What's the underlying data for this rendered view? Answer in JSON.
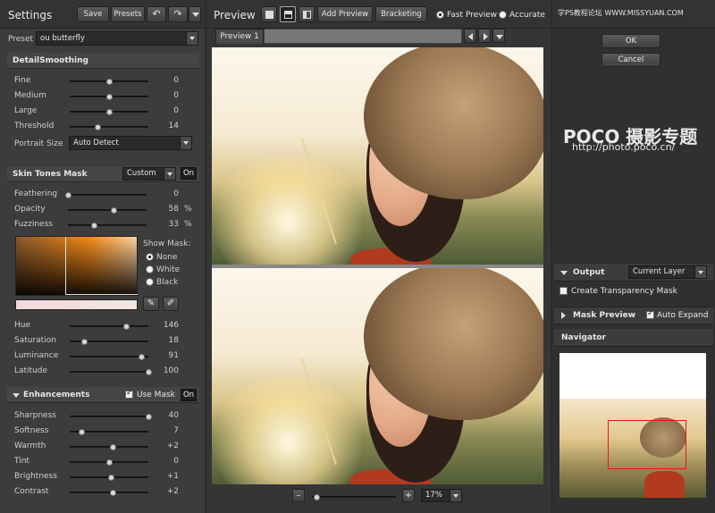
{
  "left": {
    "title": "Settings",
    "save_label": "Save",
    "presets_label": "Presets",
    "preset_label": "Preset",
    "preset_value": "ou butterfly",
    "detail": {
      "title": "DetailSmoothing",
      "sliders": [
        {
          "label": "Fine",
          "value": "0",
          "pos": 0.5
        },
        {
          "label": "Medium",
          "value": "0",
          "pos": 0.5
        },
        {
          "label": "Large",
          "value": "0",
          "pos": 0.5
        },
        {
          "label": "Threshold",
          "value": "14",
          "pos": 0.35
        }
      ],
      "portrait_label": "Portrait Size",
      "portrait_value": "Auto Detect"
    },
    "skin": {
      "title": "Skin Tones Mask",
      "mode": "Custom",
      "on_label": "On",
      "sliders": [
        {
          "label": "Feathering",
          "value": "0",
          "unit": "",
          "pos": 0.0
        },
        {
          "label": "Opacity",
          "value": "58",
          "unit": "%",
          "pos": 0.58
        },
        {
          "label": "Fuzziness",
          "value": "33",
          "unit": "%",
          "pos": 0.33
        }
      ],
      "show_mask_label": "Show Mask:",
      "mask_options": [
        "None",
        "White",
        "Black"
      ],
      "color_sliders": [
        {
          "label": "Hue",
          "value": "146",
          "pos": 0.72
        },
        {
          "label": "Saturation",
          "value": "18",
          "pos": 0.18
        },
        {
          "label": "Luminance",
          "value": "91",
          "pos": 0.91
        },
        {
          "label": "Latitude",
          "value": "100",
          "pos": 1.0
        }
      ]
    },
    "enh": {
      "title": "Enhancements",
      "use_mask_label": "Use Mask",
      "on_label": "On",
      "sliders": [
        {
          "label": "Sharpness",
          "value": "40",
          "pos": 1.0
        },
        {
          "label": "Softness",
          "value": "7",
          "pos": 0.15
        },
        {
          "label": "Warmth",
          "value": "+2",
          "pos": 0.55
        },
        {
          "label": "Tint",
          "value": "0",
          "pos": 0.5
        },
        {
          "label": "Brightness",
          "value": "+1",
          "pos": 0.52
        },
        {
          "label": "Contrast",
          "value": "+2",
          "pos": 0.55
        }
      ]
    }
  },
  "center": {
    "title": "Preview",
    "add_preview_label": "Add Preview",
    "bracketing_label": "Bracketing",
    "fast_preview_label": "Fast Preview",
    "accurate_label": "Accurate",
    "tab_label": "Preview 1",
    "zoom_value": "17%"
  },
  "right": {
    "watermark": "学PS教程论坛 WWW.MISSYUAN.COM",
    "ok_label": "OK",
    "cancel_label": "Cancel",
    "poco_brand": "POCO 摄影专题",
    "poco_url": "http://photo.poco.cn/",
    "output_label": "Output",
    "output_value": "Current Layer",
    "transparency_label": "Create Transparency Mask",
    "mask_preview_label": "Mask Preview",
    "auto_expand_label": "Auto Expand",
    "navigator_label": "Navigator"
  }
}
